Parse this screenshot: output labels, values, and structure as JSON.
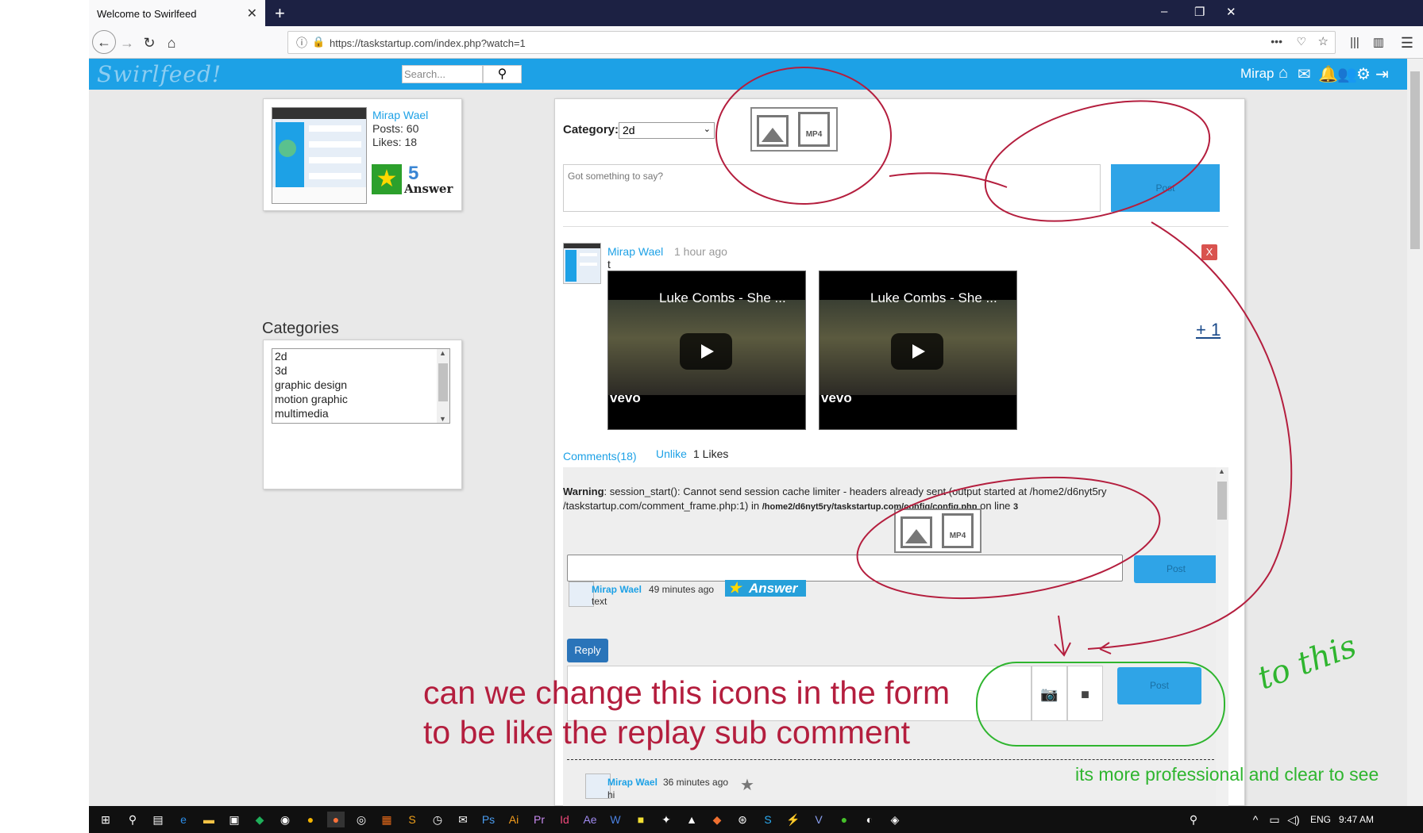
{
  "browser": {
    "tab_title": "Welcome to Swirlfeed",
    "tab_close": "✕",
    "new_tab": "+",
    "url": "https://taskstartup.com/index.php?watch=1",
    "window_controls": [
      "–",
      "❐",
      "✕"
    ]
  },
  "site": {
    "logo": "Swirlfeed!",
    "search_placeholder": "Search...",
    "user_name": "Mirap"
  },
  "profile": {
    "name": "Mirap Wael",
    "posts": "Posts: 60",
    "likes": "Likes: 18",
    "answer_count": "5",
    "answer_label": "Answer"
  },
  "categories": {
    "title": "Categories",
    "items": [
      "2d",
      "3d",
      "graphic design",
      "motion graphic",
      "multimedia"
    ]
  },
  "composer": {
    "category_label": "Category:",
    "category_value": "2d",
    "placeholder": "Got something to say?",
    "post_label": "Post",
    "mp4_label": "MP4"
  },
  "post": {
    "author": "Mirap Wael",
    "time": "1 hour ago",
    "text": "t",
    "delete_label": "X",
    "plus_one": "+ 1",
    "videos": [
      {
        "title": "Luke Combs - She ...",
        "brand": "vevo"
      },
      {
        "title": "Luke Combs - She ...",
        "brand": "vevo"
      }
    ],
    "comments_link": "Comments(18)",
    "unlike_label": "Unlike",
    "likes_text": "1 Likes"
  },
  "comment_frame": {
    "warning_label": "Warning",
    "warning_text": ": session_start(): Cannot send session cache limiter - headers already sent (output started at /home2/d6nyt5ry /taskstartup.com/comment_frame.php:1) in ",
    "warning_path": "/home2/d6nyt5ry/taskstartup.com/config/config.php",
    "warning_suffix": " on line ",
    "warning_line": "3",
    "post_label": "Post",
    "mp4_label": "MP4",
    "comments": [
      {
        "author": "Mirap Wael",
        "time": "49 minutes ago",
        "text": "text",
        "badge": "Answer"
      },
      {
        "author": "Mirap Wael",
        "time": "36 minutes ago",
        "text": "hi"
      }
    ],
    "reply_label": "Reply",
    "reply_post_label": "Post"
  },
  "annotations": {
    "red_line1": "can we change this icons in the form",
    "red_line2": "to be like the replay sub comment",
    "green_to_this": "to this",
    "green_note": "its more professional and clear to see"
  },
  "taskbar": {
    "lang": "ENG",
    "time": "9:47 AM"
  },
  "colors": {
    "brand": "#1da1e6",
    "annotation_red": "#b41e3e",
    "annotation_green": "#2fb52f"
  }
}
